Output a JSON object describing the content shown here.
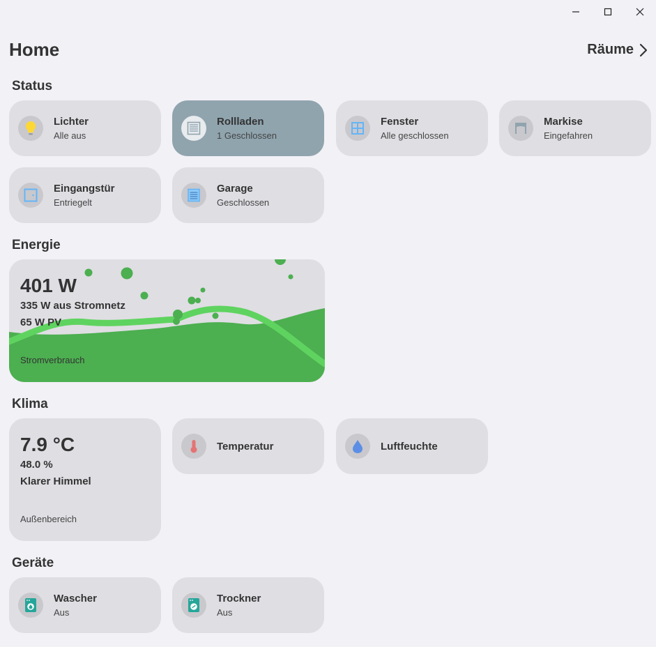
{
  "header": {
    "title": "Home",
    "rooms_link": "Räume"
  },
  "sections": {
    "status": "Status",
    "energy": "Energie",
    "climate": "Klima",
    "devices": "Geräte"
  },
  "status_tiles": [
    {
      "title": "Lichter",
      "subtitle": "Alle aus",
      "icon": "lightbulb-icon",
      "active": false
    },
    {
      "title": "Rollladen",
      "subtitle": "1 Geschlossen",
      "icon": "shutter-icon",
      "active": true
    },
    {
      "title": "Fenster",
      "subtitle": "Alle geschlossen",
      "icon": "window-icon",
      "active": false
    },
    {
      "title": "Markise",
      "subtitle": "Eingefahren",
      "icon": "awning-icon",
      "active": false
    },
    {
      "title": "Eingangstür",
      "subtitle": "Entriegelt",
      "icon": "door-icon",
      "active": false
    },
    {
      "title": "Garage",
      "subtitle": "Geschlossen",
      "icon": "garage-icon",
      "active": false
    }
  ],
  "energy": {
    "total": "401 W",
    "grid": "335 W aus Stromnetz",
    "pv": "65 W PV",
    "caption": "Stromverbrauch"
  },
  "climate": {
    "temperature": "7.9 °C",
    "humidity": "48.0 %",
    "condition": "Klarer Himmel",
    "caption": "Außenbereich",
    "tiles": [
      {
        "title": "Temperatur",
        "icon": "thermometer-icon"
      },
      {
        "title": "Luftfeuchte",
        "icon": "water-drop-icon"
      }
    ]
  },
  "devices": [
    {
      "title": "Wascher",
      "subtitle": "Aus",
      "icon": "washer-icon"
    },
    {
      "title": "Trockner",
      "subtitle": "Aus",
      "icon": "dryer-icon"
    }
  ],
  "colors": {
    "background": "#f2f1f6",
    "tile": "#dfdee3",
    "tile_active": "#90a4ae",
    "energy_green": "#4caf50",
    "energy_line": "#5fd35f",
    "icon_blue": "#64b5f6",
    "icon_yellow": "#fdd835",
    "icon_red": "#e57373",
    "icon_teal": "#26a69a"
  }
}
